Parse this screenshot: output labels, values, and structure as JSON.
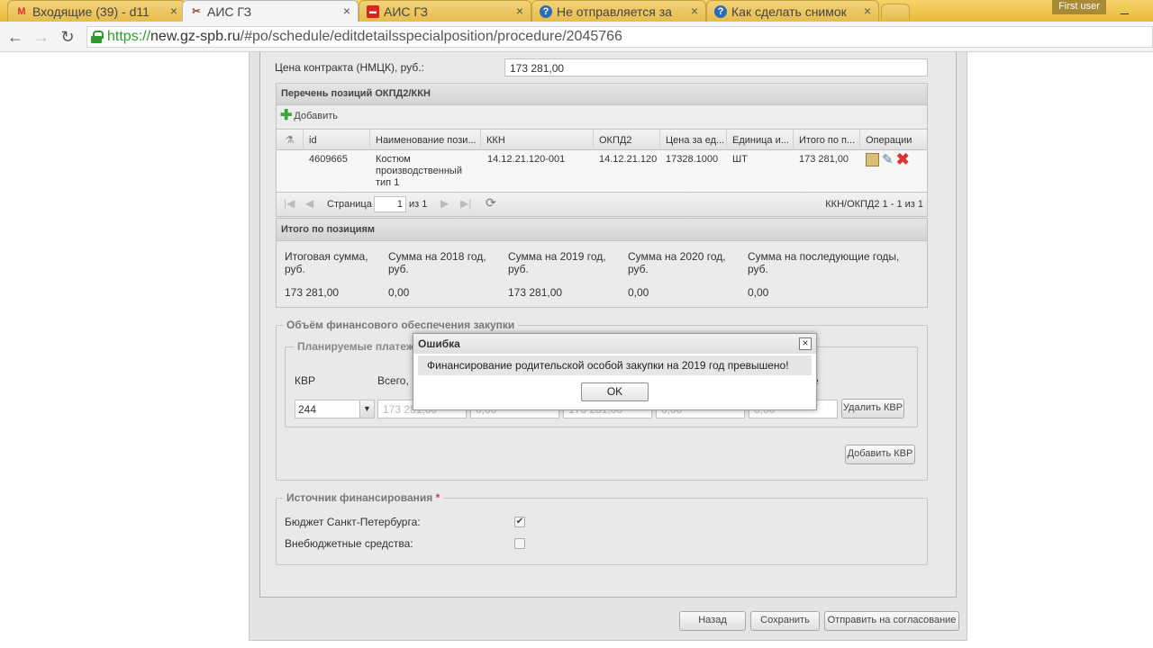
{
  "browser": {
    "tabs": [
      {
        "label": "Входящие (39) - d11",
        "icon": "gmail-icon"
      },
      {
        "label": "АИС ГЗ",
        "icon": "tools-icon"
      },
      {
        "label": "АИС ГЗ",
        "icon": "ais-icon"
      },
      {
        "label": "Не отправляется за",
        "icon": "help-icon"
      },
      {
        "label": "Как сделать снимок",
        "icon": "help-icon"
      }
    ],
    "user": "First user",
    "url_https": "https://",
    "url_host": "new.gz-spb.ru",
    "url_rest": "/#po/schedule/editdetailsspecialposition/procedure/2045766"
  },
  "contract": {
    "label": "Цена контракта (НМЦК), руб.:",
    "value": "173 281,00"
  },
  "positions": {
    "title": "Перечень позиций ОКПД2/ККН",
    "add_label": "Добавить",
    "columns": [
      "id",
      "Наименование пози...",
      "ККН",
      "ОКПД2",
      "Цена за ед...",
      "Единица и...",
      "Итого по п...",
      "Операции"
    ],
    "rows": [
      {
        "id": "4609665",
        "name": "Костюм производственный тип 1",
        "kkn": "14.12.21.120-001",
        "okpd2": "14.12.21.120",
        "price": "17328.1000",
        "unit": "ШТ",
        "total": "173 281,00"
      }
    ],
    "pager": {
      "page_label": "Страница",
      "page": "1",
      "of": "из 1",
      "info": "ККН/ОКПД2 1 - 1 из 1"
    }
  },
  "totals": {
    "title": "Итого по позициям",
    "columns": [
      {
        "label": "Итоговая сумма, руб.",
        "value": "173 281,00"
      },
      {
        "label": "Сумма на 2018 год, руб.",
        "value": "0,00"
      },
      {
        "label": "Сумма на 2019 год, руб.",
        "value": "173 281,00"
      },
      {
        "label": "Сумма на 2020 год, руб.",
        "value": "0,00"
      },
      {
        "label": "Сумма на последующие годы, руб.",
        "value": "0,00"
      }
    ]
  },
  "finance": {
    "legend": "Объём финансового обеспечения закупки",
    "payments_legend": "Планируемые платеж",
    "kvr_label": "КВР",
    "total_label": "Всего,",
    "col_tail": "е",
    "kvr_value": "244",
    "values": [
      "173 281,00",
      "0,00",
      "173 281,00",
      "0,00",
      "0,00"
    ],
    "delete_kvr": "Удалить КВР",
    "add_kvr": "Добавить КВР"
  },
  "source": {
    "legend": "Источник финансирования",
    "required": "*",
    "items": [
      {
        "label": "Бюджет Санкт-Петербурга:",
        "checked": true
      },
      {
        "label": "Внебюджетные средства:",
        "checked": false
      }
    ]
  },
  "footer": {
    "back": "Назад",
    "save": "Сохранить",
    "send": "Отправить на согласование"
  },
  "dialog": {
    "title": "Ошибка",
    "message": "Финансирование родительской особой закупки на 2019 год превышено!",
    "ok": "OK"
  }
}
